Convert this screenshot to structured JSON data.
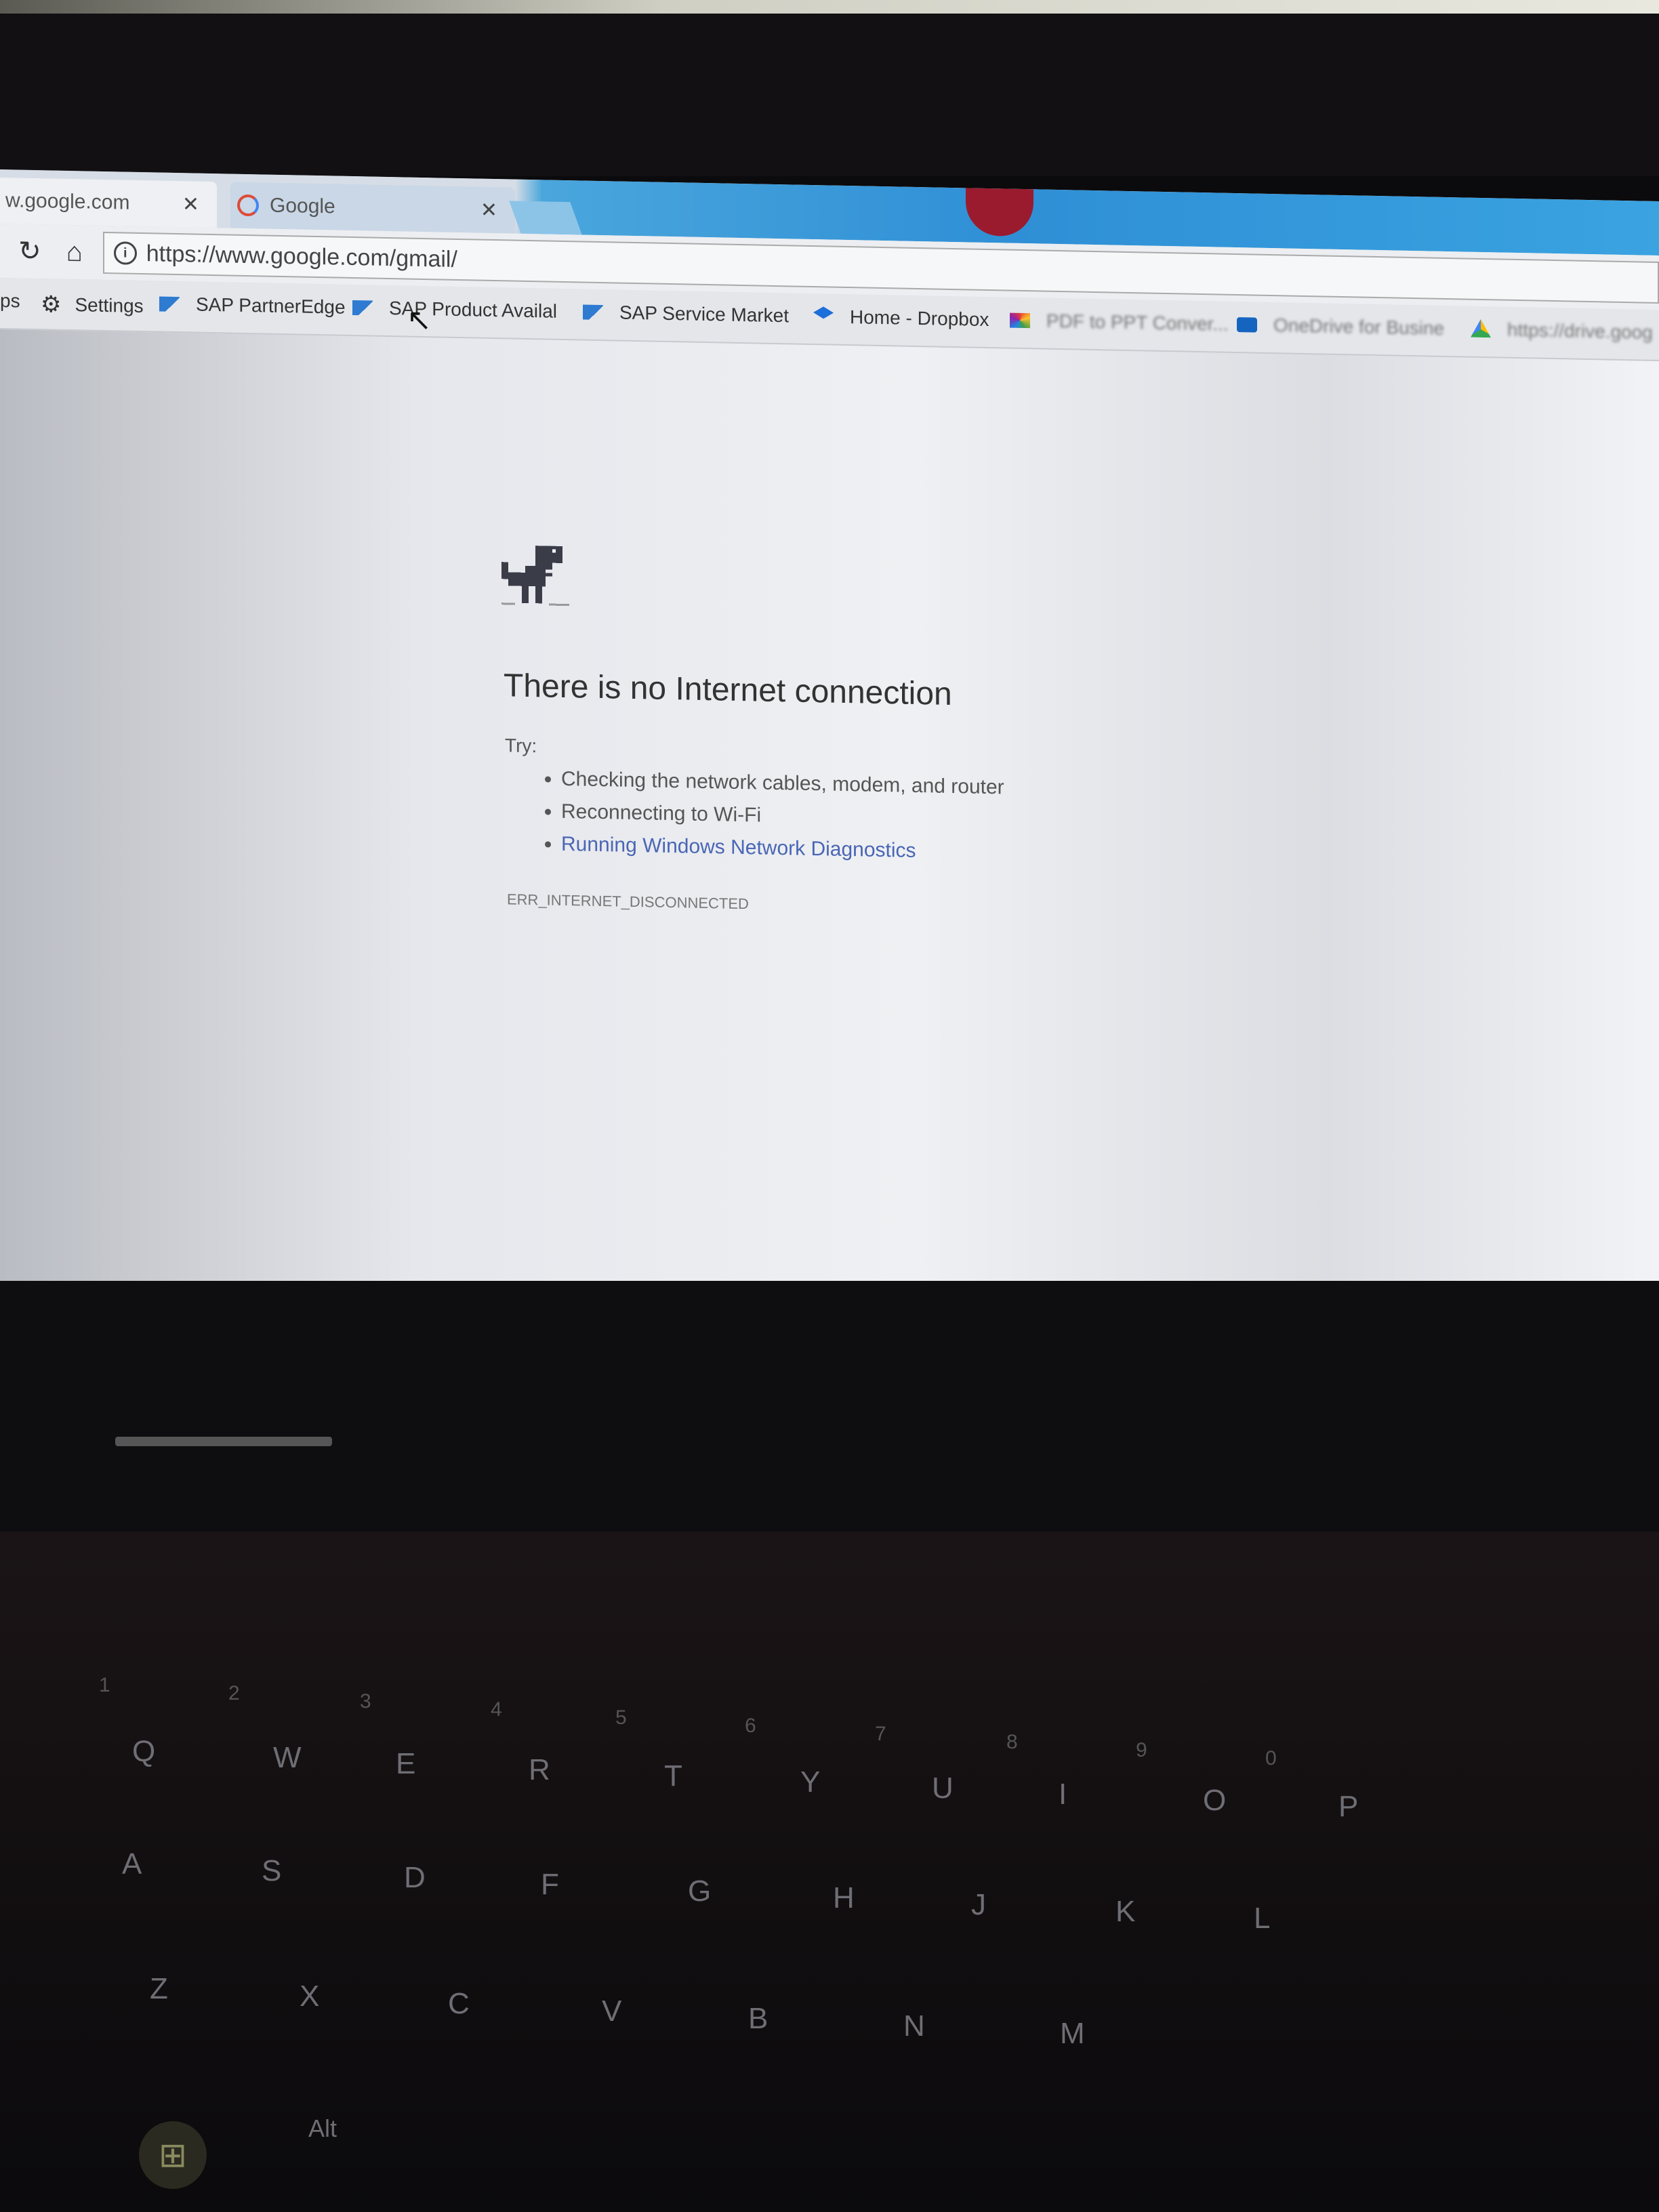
{
  "browser": {
    "tabs": [
      {
        "label": "w.google.com",
        "close": "✕"
      },
      {
        "label": "Google",
        "close": "✕"
      }
    ],
    "toolbar": {
      "reload_icon": "↻",
      "home_icon": "⌂",
      "url": "https://www.google.com/gmail/"
    },
    "bookmarks": [
      {
        "label": "ps"
      },
      {
        "label": "Settings",
        "icon": "gear-icon"
      },
      {
        "label": "SAP PartnerEdge",
        "icon": "sap-icon"
      },
      {
        "label": "SAP Product Availal",
        "icon": "sap-icon"
      },
      {
        "label": "SAP Service Market",
        "icon": "sap-icon"
      },
      {
        "label": "Home - Dropbox",
        "icon": "dropbox-icon"
      },
      {
        "label": "PDF to PPT Conver...",
        "icon": "pdf-converter-icon"
      },
      {
        "label": "OneDrive for Busine",
        "icon": "onedrive-icon"
      },
      {
        "label": "https://drive.goog",
        "icon": "google-drive-icon"
      }
    ]
  },
  "error_page": {
    "heading": "There is no Internet connection",
    "try_label": "Try:",
    "suggestions": [
      "Checking the network cables, modem, and router",
      "Reconnecting to Wi-Fi",
      "Running Windows Network Diagnostics"
    ],
    "error_code": "ERR_INTERNET_DISCONNECTED"
  },
  "keyboard": {
    "numbers": [
      "1",
      "2",
      "3",
      "4",
      "5",
      "6",
      "7",
      "8",
      "9",
      "0"
    ],
    "row1": [
      "Q",
      "W",
      "E",
      "R",
      "T",
      "Y",
      "U",
      "I",
      "O",
      "P"
    ],
    "row2": [
      "A",
      "S",
      "D",
      "F",
      "G",
      "H",
      "J",
      "K",
      "L"
    ],
    "row3": [
      "Z",
      "X",
      "C",
      "V",
      "B",
      "N",
      "M"
    ],
    "alt": "Alt"
  }
}
